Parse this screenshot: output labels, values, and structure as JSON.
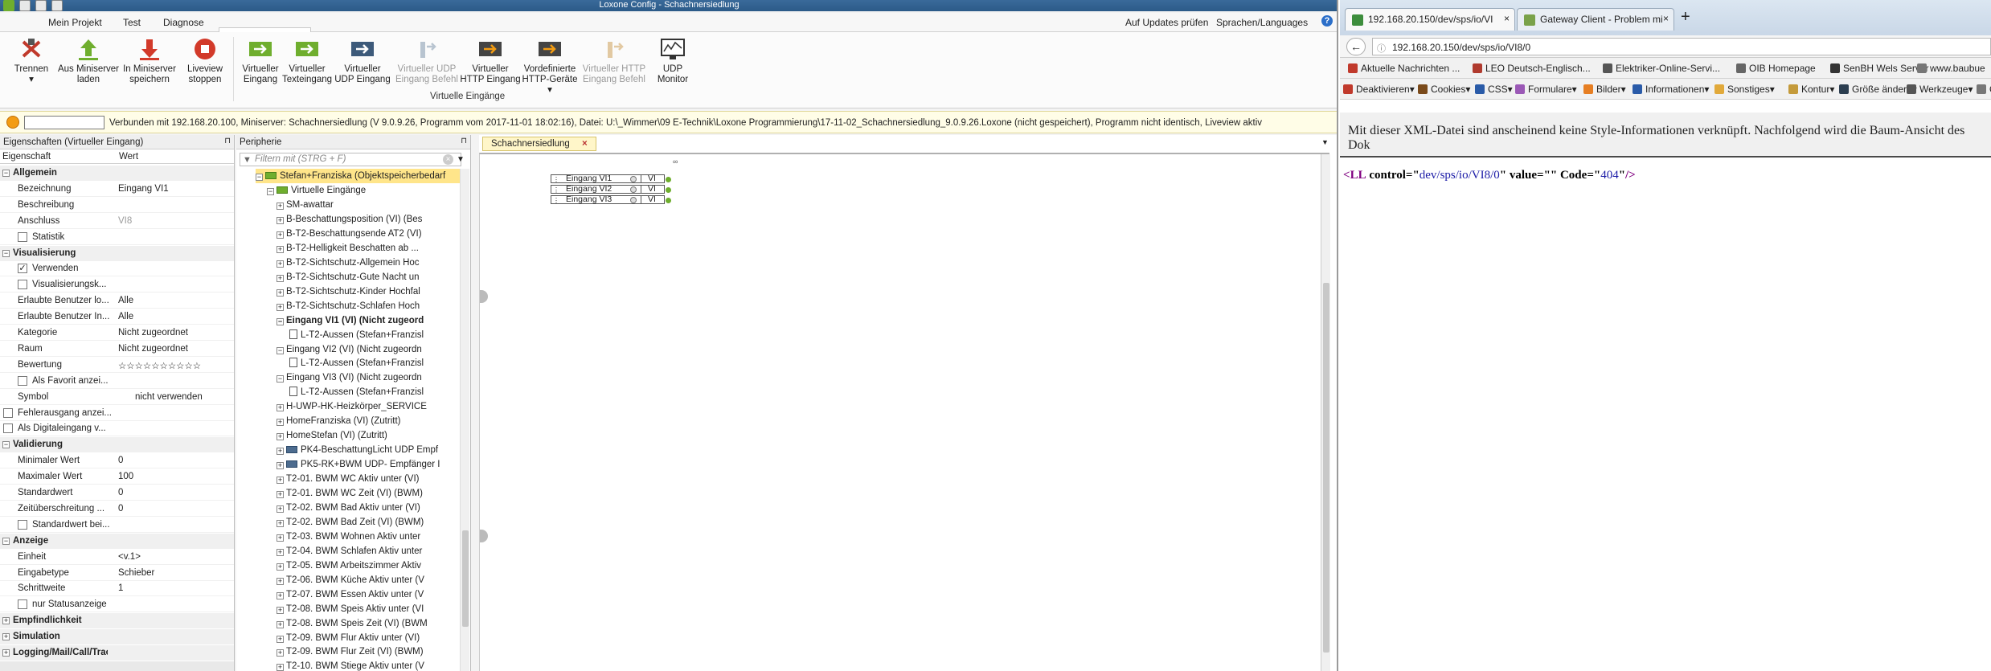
{
  "app": {
    "title": "Loxone Config - Schachnersiedlung",
    "menu": [
      "Mein Projekt",
      "Test",
      "Diagnose",
      "Virtuelle Eingänge"
    ],
    "right_menu": [
      "Auf Updates prüfen",
      "Sprachen/Languages"
    ],
    "ribbon": {
      "buttons": [
        {
          "label": "Trennen",
          "label2": "▾",
          "enabled": true
        },
        {
          "label": "Aus Miniserver",
          "label2": "laden",
          "enabled": true
        },
        {
          "label": "In Miniserver",
          "label2": "speichern",
          "enabled": true
        },
        {
          "label": "Liveview",
          "label2": "stoppen",
          "enabled": true
        },
        {
          "label": "Virtueller",
          "label2": "Eingang",
          "enabled": true
        },
        {
          "label": "Virtueller",
          "label2": "Texteingang",
          "enabled": true
        },
        {
          "label": "Virtueller",
          "label2": "UDP Eingang",
          "enabled": true
        },
        {
          "label": "Virtueller UDP",
          "label2": "Eingang Befehl",
          "enabled": false
        },
        {
          "label": "Virtueller",
          "label2": "HTTP Eingang",
          "enabled": true
        },
        {
          "label": "Vordefinierte",
          "label2": "HTTP-Geräte ▾",
          "enabled": true
        },
        {
          "label": "Virtueller HTTP",
          "label2": "Eingang Befehl",
          "enabled": false
        },
        {
          "label": "UDP",
          "label2": "Monitor",
          "enabled": true
        }
      ],
      "group_label": "Virtuelle Eingänge"
    },
    "status": "Verbunden mit 192.168.20.100, Miniserver: Schachnersiedlung (V 9.0.9.26, Programm vom 2017-11-01 18:02:16), Datei: U:\\_Wimmer\\09 E-Technik\\Loxone Programmierung\\17-11-02_Schachnersiedlung_9.0.9.26.Loxone (nicht gespeichert), Programm nicht identisch, Liveview aktiv",
    "properties": {
      "title": "Eigenschaften (Virtueller Eingang)",
      "col_property": "Eigenschaft",
      "col_value": "Wert",
      "rows": [
        {
          "type": "section",
          "key": "Allgemein",
          "exp": "−"
        },
        {
          "key": "Bezeichnung",
          "value": "Eingang VI1"
        },
        {
          "key": "Beschreibung",
          "value": ""
        },
        {
          "key": "Anschluss",
          "value": "VI8",
          "disabled": true
        },
        {
          "key": "Statistik",
          "check": "",
          "indent": 1
        },
        {
          "type": "section",
          "key": "Visualisierung",
          "exp": "−"
        },
        {
          "key": "Verwenden",
          "check": "✓",
          "indent": 1
        },
        {
          "key": "Visualisierungsk...",
          "check": "",
          "indent": 1
        },
        {
          "key": "Erlaubte Benutzer lo...",
          "value": "Alle"
        },
        {
          "key": "Erlaubte Benutzer In...",
          "value": "Alle"
        },
        {
          "key": "Kategorie",
          "value": "Nicht zugeordnet"
        },
        {
          "key": "Raum",
          "value": "Nicht zugeordnet"
        },
        {
          "key": "Bewertung",
          "value": "☆☆☆☆☆☆☆☆☆☆"
        },
        {
          "key": "Als Favorit anzei...",
          "check": "",
          "indent": 1
        },
        {
          "key": "Symbol",
          "value": "nicht verwenden",
          "vshift": true
        },
        {
          "key": "Fehlerausgang anzei...",
          "check": "",
          "indent": 0
        },
        {
          "key": "Als Digitaleingang v...",
          "check": "",
          "indent": 0
        },
        {
          "type": "section",
          "key": "Validierung",
          "exp": "−"
        },
        {
          "key": "Minimaler Wert",
          "value": "0"
        },
        {
          "key": "Maximaler Wert",
          "value": "100"
        },
        {
          "key": "Standardwert",
          "value": "0"
        },
        {
          "key": "Zeitüberschreitung ...",
          "value": "0"
        },
        {
          "key": "Standardwert bei...",
          "check": "",
          "indent": 1
        },
        {
          "type": "section",
          "key": "Anzeige",
          "exp": "−"
        },
        {
          "key": "Einheit",
          "value": "<v.1>"
        },
        {
          "key": "Eingabetype",
          "value": "Schieber"
        },
        {
          "key": "Schrittweite",
          "value": "1"
        },
        {
          "key": "nur Statusanzeige",
          "check": "",
          "indent": 1
        },
        {
          "type": "section",
          "key": "Empfindlichkeit",
          "exp": "+"
        },
        {
          "type": "section",
          "key": "Simulation",
          "exp": "+"
        },
        {
          "type": "section",
          "key": "Logging/Mail/Call/Track",
          "exp": "+"
        }
      ]
    },
    "periphery": {
      "title": "Peripherie",
      "filter_placeholder": "Filtern mit (STRG + F)",
      "root": "Stefan+Franziska (Objektspeicherbedarf",
      "folder": "Virtuelle Eingänge",
      "items": [
        {
          "label": "SM-awattar",
          "level": 2,
          "exp": "+",
          "icon": "green"
        },
        {
          "label": "B-Beschattungsposition (VI) (Bes",
          "level": 2,
          "exp": "+",
          "icon": "green"
        },
        {
          "label": "B-T2-Beschattungsende AT2 (VI)",
          "level": 2,
          "exp": "+",
          "icon": "green"
        },
        {
          "label": "B-T2-Helligkeit Beschatten ab ...",
          "level": 2,
          "exp": "+",
          "icon": "green"
        },
        {
          "label": "B-T2-Sichtschutz-Allgemein Hoc",
          "level": 2,
          "exp": "+",
          "icon": "green"
        },
        {
          "label": "B-T2-Sichtschutz-Gute Nacht un",
          "level": 2,
          "exp": "+",
          "icon": "green"
        },
        {
          "label": "B-T2-Sichtschutz-Kinder Hochfal",
          "level": 2,
          "exp": "+",
          "icon": "green"
        },
        {
          "label": "B-T2-Sichtschutz-Schlafen Hoch",
          "level": 2,
          "exp": "+",
          "icon": "green"
        },
        {
          "label": "Eingang VI1 (VI) (Nicht zugeord",
          "level": 2,
          "exp": "−",
          "icon": "green",
          "bold": true
        },
        {
          "label": "L-T2-Aussen (Stefan+Franzisl",
          "level": 3,
          "icon": "doc"
        },
        {
          "label": "Eingang VI2 (VI) (Nicht zugeordn",
          "level": 2,
          "exp": "−",
          "icon": "green"
        },
        {
          "label": "L-T2-Aussen (Stefan+Franzisl",
          "level": 3,
          "icon": "doc"
        },
        {
          "label": "Eingang VI3 (VI) (Nicht zugeordn",
          "level": 2,
          "exp": "−",
          "icon": "green"
        },
        {
          "label": "L-T2-Aussen (Stefan+Franzisl",
          "level": 3,
          "icon": "doc"
        },
        {
          "label": "H-UWP-HK-Heizkörper_SERVICE",
          "level": 2,
          "exp": "+",
          "icon": "green"
        },
        {
          "label": "HomeFranziska (VI) (Zutritt)",
          "level": 2,
          "exp": "+",
          "icon": "green"
        },
        {
          "label": "HomeStefan (VI) (Zutritt)",
          "level": 2,
          "exp": "+",
          "icon": "green"
        },
        {
          "label": "PK4-BeschattungLicht UDP Empf",
          "level": 2,
          "exp": "+",
          "icon": "blue"
        },
        {
          "label": "PK5-RK+BWM UDP- Empfänger I",
          "level": 2,
          "exp": "+",
          "icon": "blue"
        },
        {
          "label": "T2-01. BWM WC Aktiv unter (VI)",
          "level": 2,
          "exp": "+",
          "icon": "green"
        },
        {
          "label": "T2-01. BWM WC Zeit (VI) (BWM)",
          "level": 2,
          "exp": "+",
          "icon": "green"
        },
        {
          "label": "T2-02. BWM Bad Aktiv unter (VI)",
          "level": 2,
          "exp": "+",
          "icon": "green"
        },
        {
          "label": "T2-02. BWM Bad Zeit (VI) (BWM)",
          "level": 2,
          "exp": "+",
          "icon": "green"
        },
        {
          "label": "T2-03. BWM Wohnen Aktiv unter",
          "level": 2,
          "exp": "+",
          "icon": "green"
        },
        {
          "label": "T2-04. BWM Schlafen Aktiv unter",
          "level": 2,
          "exp": "+",
          "icon": "green"
        },
        {
          "label": "T2-05. BWM Arbeitszimmer Aktiv",
          "level": 2,
          "exp": "+",
          "icon": "green"
        },
        {
          "label": "T2-06. BWM Küche Aktiv unter (V",
          "level": 2,
          "exp": "+",
          "icon": "green"
        },
        {
          "label": "T2-07. BWM Essen Aktiv unter (V",
          "level": 2,
          "exp": "+",
          "icon": "green"
        },
        {
          "label": "T2-08. BWM Speis Aktiv unter (VI",
          "level": 2,
          "exp": "+",
          "icon": "green"
        },
        {
          "label": "T2-08. BWM Speis Zeit (VI) (BWM",
          "level": 2,
          "exp": "+",
          "icon": "green"
        },
        {
          "label": "T2-09. BWM Flur Aktiv unter (VI)",
          "level": 2,
          "exp": "+",
          "icon": "green"
        },
        {
          "label": "T2-09. BWM Flur Zeit (VI) (BWM)",
          "level": 2,
          "exp": "+",
          "icon": "green"
        },
        {
          "label": "T2-10. BWM Stiege Aktiv unter (V",
          "level": 2,
          "exp": "+",
          "icon": "green"
        }
      ]
    },
    "document_tab": "Schachnersiedlung",
    "blocks": [
      {
        "name": "Eingang VI1",
        "tag": "VI"
      },
      {
        "name": "Eingang VI2",
        "tag": "VI"
      },
      {
        "name": "Eingang VI3",
        "tag": "VI"
      }
    ]
  },
  "browser": {
    "tabs": [
      {
        "label": "192.168.20.150/dev/sps/io/VI",
        "active": true
      },
      {
        "label": "Gateway Client - Problem mi",
        "active": false
      }
    ],
    "url": "192.168.20.150/dev/sps/io/VI8/0",
    "bookmarks": [
      "Aktuelle Nachrichten ...",
      "LEO Deutsch-Englisch...",
      "Elektriker-Online-Servi...",
      "OIB Homepage",
      "SenBH Wels Server",
      "www.baubue"
    ],
    "webdev": [
      "Deaktivieren▾",
      "Cookies▾",
      "CSS▾",
      "Formulare▾",
      "Bilder▾",
      "Informationen▾",
      "Sonstiges▾",
      "Kontur▾",
      "Größe ändern▾",
      "Werkzeuge▾",
      "Q"
    ],
    "xml_note": "Mit dieser XML-Datei sind anscheinend keine Style-Informationen verknüpft. Nachfolgend wird die Baum-Ansicht des Dok",
    "xml": {
      "tag": "LL",
      "control_attr": "control",
      "control": "dev/sps/io/VI8/0",
      "value_attr": "value",
      "value": "",
      "code_attr": "Code",
      "code": "404"
    }
  }
}
